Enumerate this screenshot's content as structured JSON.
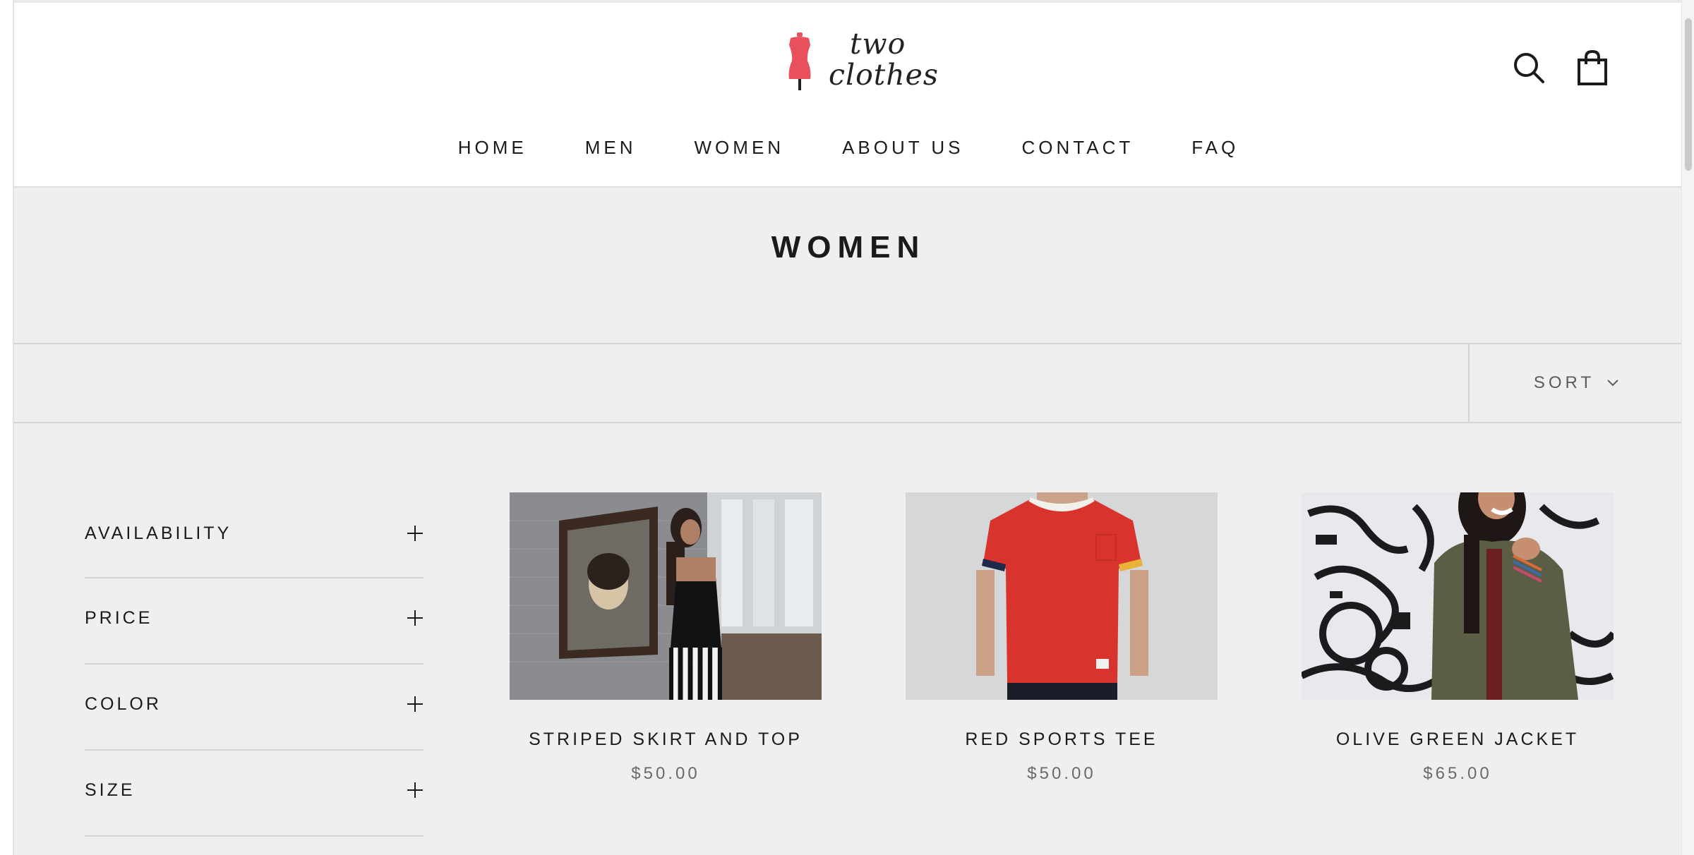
{
  "brand": {
    "line1": "two",
    "line2": "clothes",
    "accent_color": "#e8505b"
  },
  "header_icons": {
    "search": "search-icon",
    "cart": "shopping-bag-icon"
  },
  "nav": [
    "HOME",
    "MEN",
    "WOMEN",
    "ABOUT US",
    "CONTACT",
    "FAQ"
  ],
  "page_title": "WOMEN",
  "toolbar": {
    "sort_label": "SORT",
    "sort_icon": "chevron-down-icon"
  },
  "filters": [
    "AVAILABILITY",
    "PRICE",
    "COLOR",
    "SIZE"
  ],
  "products": [
    {
      "name": "STRIPED SKIRT AND TOP",
      "price": "$50.00"
    },
    {
      "name": "RED SPORTS TEE",
      "price": "$50.00"
    },
    {
      "name": "OLIVE GREEN JACKET",
      "price": "$65.00"
    }
  ]
}
